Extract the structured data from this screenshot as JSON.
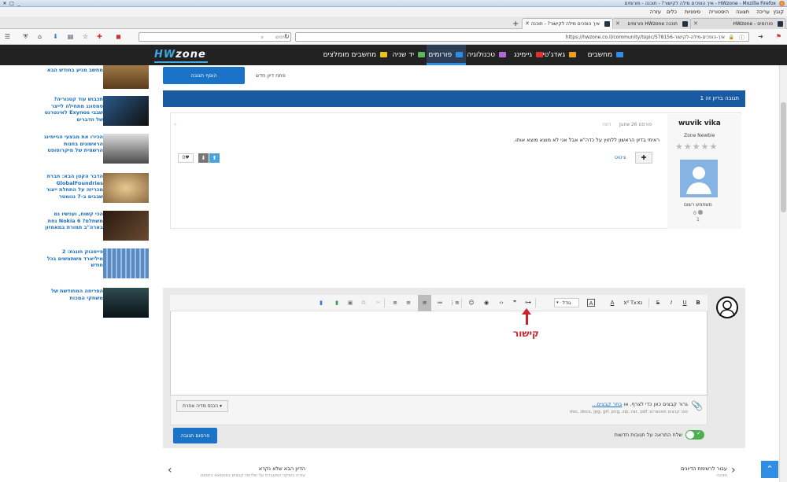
{
  "window": {
    "title": "איך הופכים מילה לקישור? - תוכנה - פורומים - HWzone - Mozilla Firefox"
  },
  "menu": {
    "items": [
      "קובץ",
      "עריכה",
      "תצוגה",
      "היסטוריה",
      "סימניות",
      "כלים",
      "עזרה"
    ]
  },
  "tabs": [
    {
      "label": "פורומים - HWzone",
      "active": false
    },
    {
      "label": "תוכנה HWzone פורומים",
      "active": false
    },
    {
      "label": "איך הופכים מילה לקישור? - תוכנה",
      "active": true
    }
  ],
  "nav": {
    "url": "https://hwzone.co.il/community/topic/578156-איך-הופכים-מילה-לקישור",
    "search_placeholder": "חיפוש"
  },
  "site": {
    "logo_prefix": "HW",
    "logo_suffix": "zone",
    "menu": [
      {
        "label": "מחשבים",
        "color": "#2f8de4"
      },
      {
        "label": "גאדג'טים",
        "color": "#f0a020"
      },
      {
        "label": "גיימינג",
        "color": "#e03030"
      },
      {
        "label": "טכנולוגיה",
        "color": "#b06ad8"
      },
      {
        "label": "פורומים",
        "color": "#2f8de4"
      },
      {
        "label": "יד שניה",
        "color": "#5cb85c"
      },
      {
        "label": "מחשבים מומלצים",
        "color": "#e8c020"
      }
    ]
  },
  "sidebar": {
    "items": [
      {
        "text": "מחשב מגיע בחודש הבא",
        "thumb": "#8a6a3a"
      },
      {
        "text": "תכבוש עוד קטגוריה? סמסונג מתחילה לייצר שבבי Exynos לאינטרנט של הדברים",
        "thumb": "#222"
      },
      {
        "text": "הכירו את מבצעי הגיימינג הראשונים בחנות הרשמית של מיקרוסופט",
        "thumb": "#3a3a3a"
      },
      {
        "text": "הדבר הקטן הבא: חברת GlobalFoundries מכריזה על התחלת ייצור שבבים ב-7 ננומטר",
        "thumb": "#c8a070"
      },
      {
        "text": "הכי קשוח, ועכשיו גם משתלם? Nokia 6 נחת בארה\"ב תמורת במאמזון",
        "thumb": "#4a3020"
      },
      {
        "text": "פייסבוק חוגגת: 2 מיליארד משתמשים בכל חודש",
        "thumb": "#6a9ac8"
      },
      {
        "text": "הפריחה המחודשת של משחקי המכות",
        "thumb": "#1a2a30"
      }
    ]
  },
  "topic": {
    "add_reply_button": "הוסף תגובה",
    "new_topic_link": "פתח דיון חדש",
    "replies_header": "1 תגובה בדיון זה",
    "post": {
      "author": "wuvik vika",
      "rank": "Zone Newbie",
      "member_type": "משתמש רשום",
      "count_a": "0",
      "count_b": "1",
      "date": "פורסם June 26",
      "report": "דווח",
      "body": "ראיתי בדיון הראשון ללחוץ על כדה\"א אבל אני לא מוצא מוצא אותו.",
      "quote": "ציטוט",
      "vote_count": "0"
    }
  },
  "editor": {
    "annotation": "קישור",
    "format_dropdown": "גודל",
    "attach_text": "גרור קבצים כאן כדי לצרף, או",
    "attach_link": "בחר קבצים...",
    "allowed_types": "סוגי קבצים מאושרים: doc, docx, jpg, gif, png, zip, rar, pdf",
    "insert_media": "הכנס מדיה אחרת",
    "notify_label": "שלח התראה על תגובות חדשות",
    "submit_button": "פרסום תגובה"
  },
  "bottom": {
    "back_label": "עבור לרשימת הדיונים",
    "back_sub": "תוכנה",
    "next_label": "הדיון הבא שלא נקרא",
    "next_sub": "עזרה בשיקוי המעבדת על שליחת קבצים בווטסאפ בתחום"
  },
  "colors": {
    "accent": "#1a73c7",
    "annotation": "#d0202a",
    "nav_bg": "#222222"
  }
}
